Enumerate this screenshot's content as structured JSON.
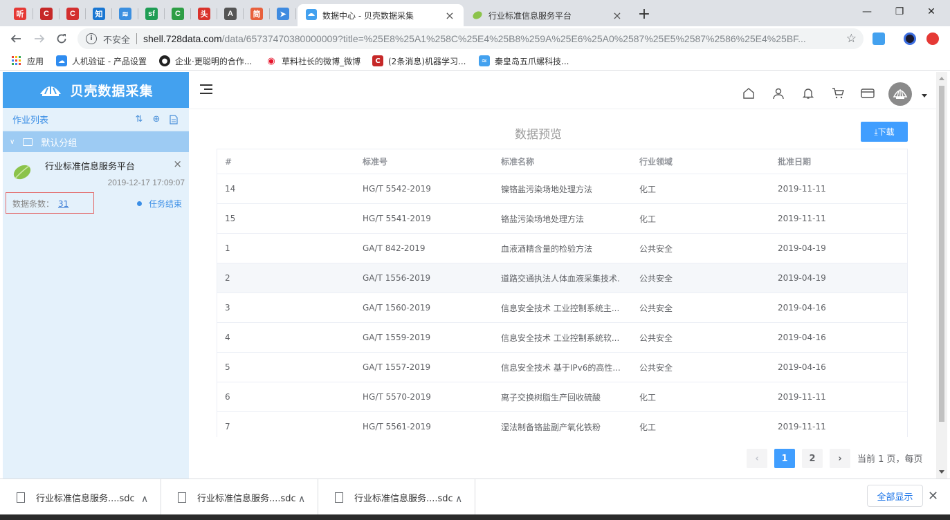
{
  "browser": {
    "pinned_tabs": [
      {
        "icon": "ting-icon",
        "glyph": "听",
        "color": "#e53935"
      },
      {
        "icon": "c-red-icon",
        "glyph": "C",
        "color": "#c62828"
      },
      {
        "icon": "csdn-icon",
        "glyph": "C",
        "color": "#d32f2f"
      },
      {
        "icon": "zhihu-icon",
        "glyph": "知",
        "color": "#1976d2"
      },
      {
        "icon": "layers-icon",
        "glyph": "≋",
        "color": "#3b8fe0"
      },
      {
        "icon": "sf-icon",
        "glyph": "sf",
        "color": "#1f9d55"
      },
      {
        "icon": "c-green-icon",
        "glyph": "C",
        "color": "#2e9e45"
      },
      {
        "icon": "toutiao-icon",
        "glyph": "头",
        "color": "#d9322b"
      },
      {
        "icon": "script-icon",
        "glyph": "A",
        "color": "#555555"
      },
      {
        "icon": "jian-icon",
        "glyph": "简",
        "color": "#e8603c"
      },
      {
        "icon": "paper-plane-icon",
        "glyph": "➤",
        "color": "#3f8be0"
      }
    ],
    "tabs": [
      {
        "title": "数据中心 - 贝壳数据采集",
        "active": true
      },
      {
        "title": "行业标准信息服务平台",
        "active": false
      }
    ],
    "window_controls": {
      "minimize": "—",
      "maximize": "❐",
      "close": "✕"
    },
    "address": {
      "security_label": "不安全",
      "host": "shell.728data.com",
      "path": "/data/65737470380000009?title=%25E8%25A1%258C%25E4%25B8%259A%25E6%25A0%2587%25E5%2587%2586%25E4%25BF..."
    },
    "bookmarks": [
      {
        "label": "应用",
        "icon": "apps-grid-icon"
      },
      {
        "label": "人机验证 - 产品设置",
        "icon": "cloud-icon"
      },
      {
        "label": "企业·更聪明的合作...",
        "icon": "github-icon"
      },
      {
        "label": "草料社长的微博_微博",
        "icon": "weibo-icon"
      },
      {
        "label": "(2条消息)机器学习...",
        "icon": "csdn-icon"
      },
      {
        "label": "秦皇岛五爪螺科技...",
        "icon": "shell-bookmark-icon"
      }
    ]
  },
  "sidebar": {
    "brand": "贝壳数据采集",
    "joblist_label": "作业列表",
    "group_label": "默认分组",
    "task": {
      "name": "行业标准信息服务平台",
      "datetime": "2019-12-17 17:09:07",
      "count_label": "数据条数：",
      "count_value": "31",
      "status": "任务结束"
    }
  },
  "main": {
    "title": "数据预览",
    "download_label": "⤓下载",
    "columns": [
      "#",
      "标准号",
      "标准名称",
      "行业领域",
      "批准日期"
    ],
    "rows": [
      [
        "14",
        "HG/T 5542-2019",
        "镍铬盐污染场地处理方法",
        "化工",
        "2019-11-11"
      ],
      [
        "15",
        "HG/T 5541-2019",
        "铬盐污染场地处理方法",
        "化工",
        "2019-11-11"
      ],
      [
        "1",
        "GA/T 842-2019",
        "血液酒精含量的检验方法",
        "公共安全",
        "2019-04-19"
      ],
      [
        "2",
        "GA/T 1556-2019",
        "道路交通执法人体血液采集技术.",
        "公共安全",
        "2019-04-19"
      ],
      [
        "3",
        "GA/T 1560-2019",
        "信息安全技术 工业控制系统主...",
        "公共安全",
        "2019-04-16"
      ],
      [
        "4",
        "GA/T 1559-2019",
        "信息安全技术 工业控制系统软...",
        "公共安全",
        "2019-04-16"
      ],
      [
        "5",
        "GA/T 1557-2019",
        "信息安全技术 基于IPv6的高性...",
        "公共安全",
        "2019-04-16"
      ],
      [
        "6",
        "HG/T 5570-2019",
        "离子交换树脂生产回收硫酸",
        "化工",
        "2019-11-11"
      ],
      [
        "7",
        "HG/T 5561-2019",
        "湿法制备铬盐副产氧化铁粉",
        "化工",
        "2019-11-11"
      ]
    ],
    "pagination": {
      "prev": "‹",
      "pages": [
        "1",
        "2"
      ],
      "current": "1",
      "next": "›",
      "info": "当前 1 页，每页"
    }
  },
  "downloads": {
    "items": [
      "行业标准信息服务....sdc",
      "行业标准信息服务....sdc",
      "行业标准信息服务....sdc"
    ],
    "show_all": "全部显示",
    "close": "✕"
  },
  "colors": {
    "brand_blue": "#43a1ef",
    "primary": "#409eff",
    "sidebar_bg": "#e4f1fb",
    "group_bg": "#9dcbf3",
    "highlight_border": "#e36a6a"
  }
}
